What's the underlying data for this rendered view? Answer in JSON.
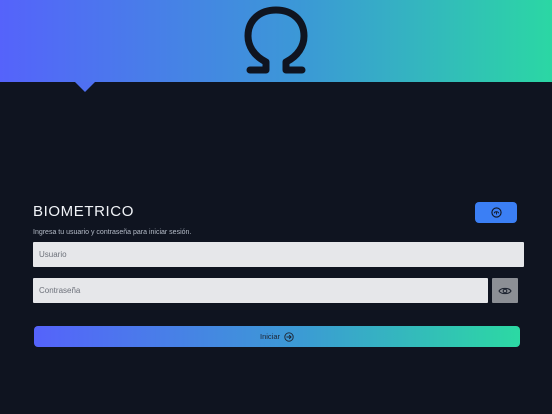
{
  "header": {
    "logo_icon": "omega-logo",
    "gradient": [
      "#5563fb",
      "#3b99d6",
      "#2bd7a4"
    ]
  },
  "login": {
    "title": "BIOMETRICO",
    "subtitle": "Ingresa tu usuario y contraseña para iniciar sesión.",
    "biometric_icon": "fingerprint-icon",
    "username_placeholder": "Usuario",
    "username_value": "",
    "password_placeholder": "Contraseña",
    "password_value": "",
    "show_password_icon": "eye-icon",
    "submit_label": "Iniciar",
    "submit_icon": "arrow-circle-right-icon"
  },
  "colors": {
    "background": "#0f1420",
    "biometric_button": "#3b7ff5",
    "eye_button": "#8c8f95"
  }
}
